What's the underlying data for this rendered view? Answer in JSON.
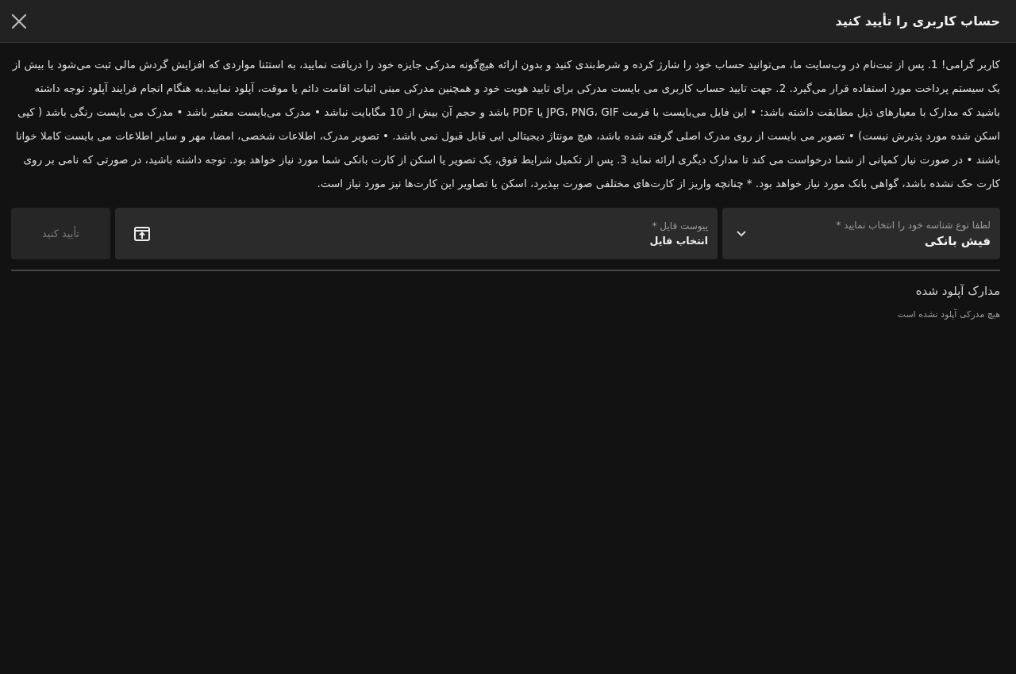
{
  "dialog": {
    "title": "حساب کاربری را تأیید کنید"
  },
  "notice": "کاربر گرامی! 1. پس از ثبت‌نام در وب‌سایت ما، می‌توانید حساب خود را شارژ کرده و شرط‌بندی کنید و بدون ارائه هیچ‌گونه مدرکی جایزه خود را دریافت نمایید، به استثنا مواردی که افزایش گردش مالی ثبت می‌شود یا بیش از یک سیستم پرداخت مورد استفاده قرار می‌گیرد. 2. جهت تایید حساب کاربری می بایست مدرکی برای تایید هویت خود و همچنین مدرکی مبنی اثبات اقامت دائم یا موقت، آپلود نمایید.به هنگام انجام فرایند آپلود توجه داشته باشید که مدارک با معیارهای ذیل مطابقت داشته باشد: • این فایل می‌بایست با فرمت JPG، PNG، GIF یا PDF باشد و حجم آن بیش از 10 مگابایت نباشد • مدرک می‌بایست معتبر باشد • مدرک می بایست رنگی باشد ( کپی اسکن شده مورد پذیرش نیست) • تصویر می بایست از روی مدرک اصلی گرفته شده باشد، هیچ مونتاژ دیجیتالی ایی قابل قبول نمی باشد. • تصویر مدرک، اطلاعات شخصی، امضا، مهر و سایر اطلاعات می بایست کاملا خوانا باشند • در صورت نیاز کمپانی از شما درخواست می کند تا مدارک دیگری ارائه نماید 3. پس از تکمیل شرایط فوق، یک تصویر یا اسکن از کارت بانکی شما مورد نیاز خواهد بود. توجه داشته باشید، در صورتی که نامی بر روی کارت حک نشده باشد، گواهی بانک مورد نیاز خواهد بود. * چنانچه واریز از کارت‌های مختلفی صورت بپذیرد، اسکن یا تصاویر این کارت‌ها نیز مورد نیاز است.",
  "form": {
    "document_type": {
      "label": "لطفا نوع شناسه خود را انتخاب نمایید *",
      "value": "فیش بانکی"
    },
    "file": {
      "label": "پیوست فایل *",
      "value": "انتخاب فایل"
    },
    "submit": {
      "label": "تأیید کنید",
      "disabled": true
    }
  },
  "uploaded": {
    "heading": "مدارک آپلود شده",
    "empty_message": "هیچ مدرکی آپلود نشده است"
  }
}
